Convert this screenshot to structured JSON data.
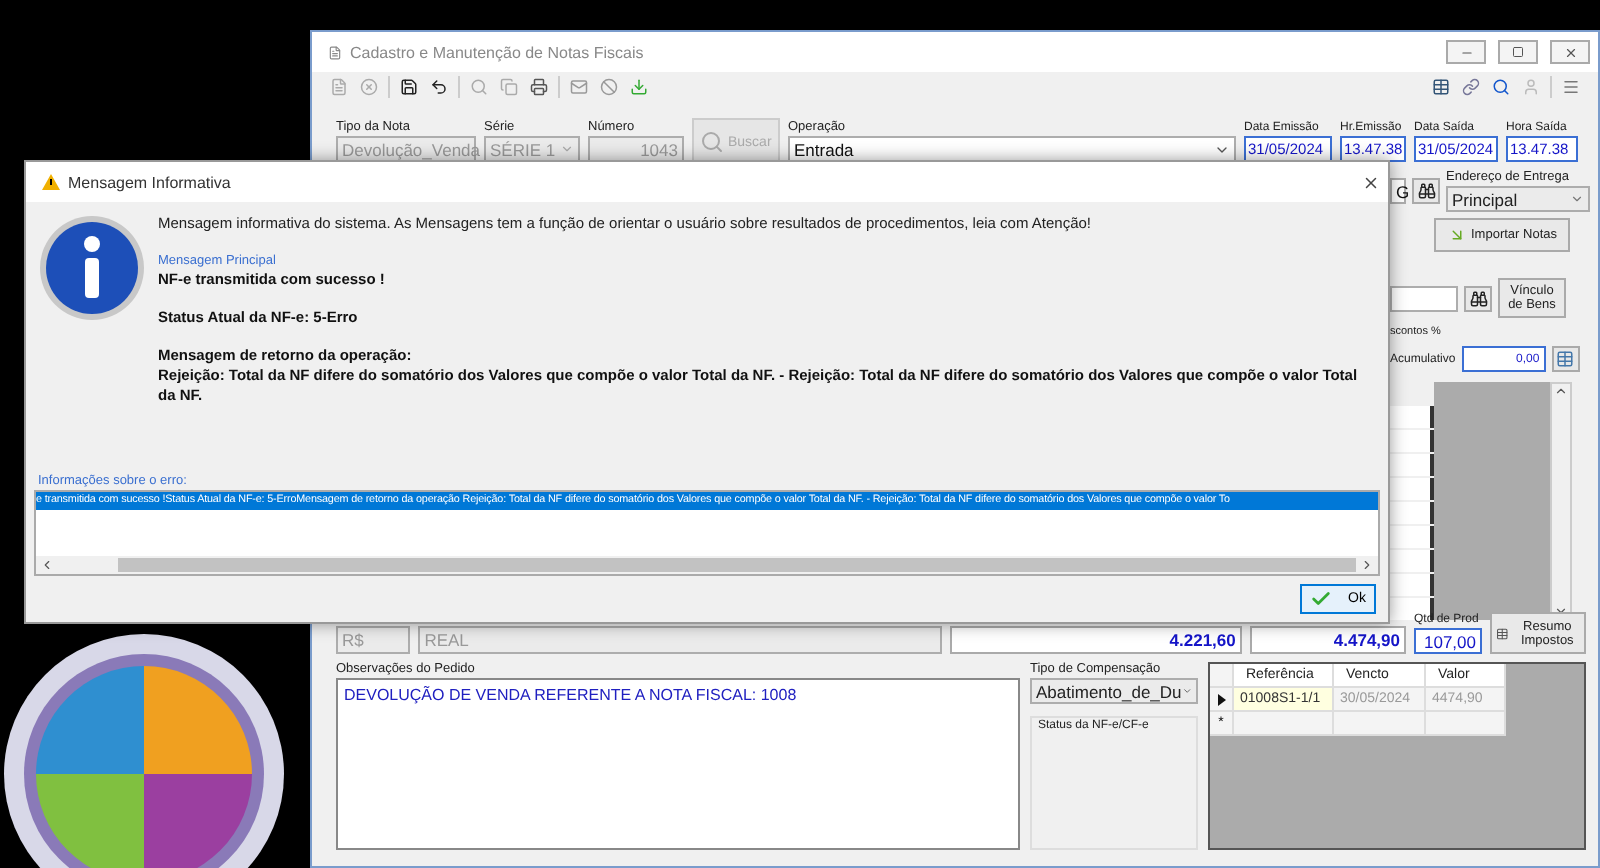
{
  "main_window": {
    "title": "Cadastro e Manutenção de Notas Fiscais",
    "header_fields": [
      {
        "label": "Tipo da Nota",
        "value": "Devolução_Venda",
        "kind": "select",
        "disabled": true
      },
      {
        "label": "Série",
        "value": "SÉRIE 1",
        "kind": "select",
        "disabled": true
      },
      {
        "label": "Número",
        "value": "1043",
        "kind": "number",
        "disabled": true
      }
    ],
    "search_button": {
      "label": "Buscar",
      "disabled": true
    },
    "operation": {
      "label": "Operação",
      "value": "Entrada"
    },
    "date_fields": [
      {
        "label": "Data Emissão",
        "value": "31/05/2024"
      },
      {
        "label": "Hr.Emissão",
        "value": "13.47.38"
      },
      {
        "label": "Data Saída",
        "value": "31/05/2024"
      },
      {
        "label": "Hora Saída",
        "value": "13.47.38"
      }
    ],
    "partial_field": {
      "value": "G"
    },
    "delivery": {
      "label": "Endereço de Entrega",
      "value": "Principal"
    },
    "import_button": "Importar Notas",
    "link_button": "Vínculo de Bens",
    "discount_label": "scontos %",
    "cumulative": {
      "label": "Acumulativo",
      "value": "0,00"
    },
    "currency": {
      "symbol": "R$",
      "name": "REAL"
    },
    "totals": [
      "4.221,60",
      "4.474,90"
    ],
    "quantity": {
      "label": "Qtd de Prod",
      "value": "107,00"
    },
    "tax_button": "Resumo Impostos",
    "notes": {
      "label": "Observações do Pedido",
      "text": "DEVOLUÇÃO DE VENDA REFERENTE A NOTA FISCAL: 1008"
    },
    "compensation": {
      "label": "Tipo de Compensação",
      "value": "Abatimento_de_Du"
    },
    "status_group": {
      "label": "Status da NF-e/CF-e"
    },
    "installments": {
      "columns": [
        "Referência",
        "Vencto",
        "Valor"
      ],
      "rows": [
        {
          "cells": [
            "01008S1-1/1",
            "30/05/2024",
            "4474,90"
          ],
          "selected": true
        }
      ],
      "new_row_marker": "*"
    }
  },
  "dialog": {
    "title": "Mensagem Informativa",
    "intro": "Mensagem informativa do sistema. As Mensagens tem a função de orientar o usuário sobre resultados de procedimentos, leia com Atenção!",
    "main_label": "Mensagem Principal",
    "paragraphs": [
      [
        "NF-e transmitida com sucesso !"
      ],
      [
        "Status Atual da NF-e: 5-Erro"
      ],
      [
        "Mensagem de retorno da operação:",
        "Rejeição: Total da NF difere do somatório dos Valores que compõe o valor Total da NF. - Rejeição: Total da NF difere do somatório dos Valores que compõe o valor Total da NF."
      ]
    ],
    "details_label": "Informações sobre o erro:",
    "details": [
      {
        "text": "e transmitida com sucesso !Status Atual da NF-e: 5-ErroMensagem de retorno da operação Rejeição: Total da NF difere do somatório dos Valores que compõe o valor Total da NF. - Rejeição: Total da NF difere do somatório dos Valores que compõe o valor To",
        "selected": true
      }
    ],
    "ok_button": "Ok"
  }
}
